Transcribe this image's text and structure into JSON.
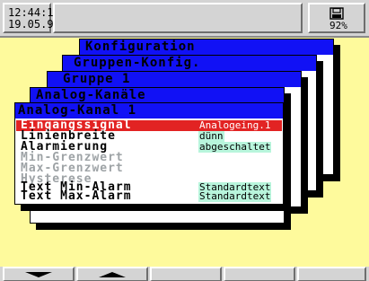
{
  "status": {
    "time": "12:44:17",
    "date": "19.05.97",
    "storage_percent": "92%",
    "storage_icon": "disk-icon"
  },
  "windows": [
    {
      "title": "Konfiguration"
    },
    {
      "title": "Gruppen-Konfig."
    },
    {
      "title": "Gruppe 1"
    },
    {
      "title": "Analog-Kanäle"
    },
    {
      "title": "Analog-Kanal 1"
    }
  ],
  "parameters": [
    {
      "label": "Eingangssignal",
      "value": "Analogeing.1",
      "state": "selected"
    },
    {
      "label": "Linienbreite",
      "value": "dünn",
      "state": "active"
    },
    {
      "label": "Alarmierung",
      "value": "abgeschaltet",
      "state": "active"
    },
    {
      "label": "Min-Grenzwert",
      "value": "",
      "state": "disabled"
    },
    {
      "label": "Max-Grenzwert",
      "value": "",
      "state": "disabled"
    },
    {
      "label": "Hysterese",
      "value": "",
      "state": "disabled"
    },
    {
      "label": "Text Min-Alarm",
      "value": "Standardtext",
      "state": "active"
    },
    {
      "label": "Text Max-Alarm",
      "value": "Standardtext",
      "state": "active"
    }
  ],
  "softkeys": [
    {
      "icon": "arrow-down-icon"
    },
    {
      "icon": "arrow-up-icon"
    },
    {
      "icon": ""
    },
    {
      "icon": ""
    },
    {
      "icon": ""
    }
  ],
  "colors": {
    "background": "#FEFA9C",
    "title_bar": "#1111F5",
    "selection": "#E22323",
    "value_tint": "#B8F5DC",
    "disabled_text": "#9EA3A6"
  }
}
